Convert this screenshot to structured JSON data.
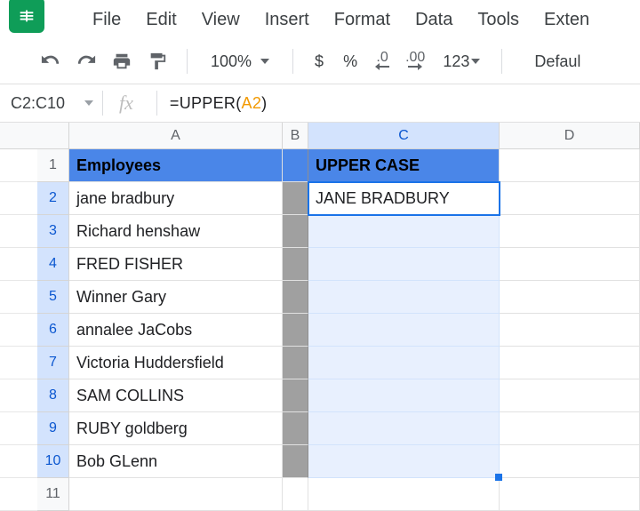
{
  "menu": {
    "items": [
      "File",
      "Edit",
      "View",
      "Insert",
      "Format",
      "Data",
      "Tools",
      "Exten"
    ]
  },
  "toolbar": {
    "zoom": "100%",
    "currency": "$",
    "percent": "%",
    "dec_dec": ".0",
    "inc_dec": ".00",
    "num_format": "123",
    "font": "Defaul"
  },
  "nameBox": "C2:C10",
  "fxLabel": "fx",
  "formula": {
    "prefix": "=UPPER",
    "open": "(",
    "ref": "A2",
    "close": ")"
  },
  "columns": [
    "A",
    "B",
    "C",
    "D"
  ],
  "rows": [
    "1",
    "2",
    "3",
    "4",
    "5",
    "6",
    "7",
    "8",
    "9",
    "10",
    "11"
  ],
  "headers": {
    "A": "Employees",
    "C": "UPPER CASE"
  },
  "colA": [
    "jane bradbury",
    "Richard henshaw",
    "FRED FISHER",
    "Winner Gary",
    "annalee JaCobs",
    "Victoria Huddersfield",
    "SAM COLLINS",
    "RUBY goldberg",
    "Bob GLenn"
  ],
  "colC": [
    "JANE BRADBURY"
  ]
}
